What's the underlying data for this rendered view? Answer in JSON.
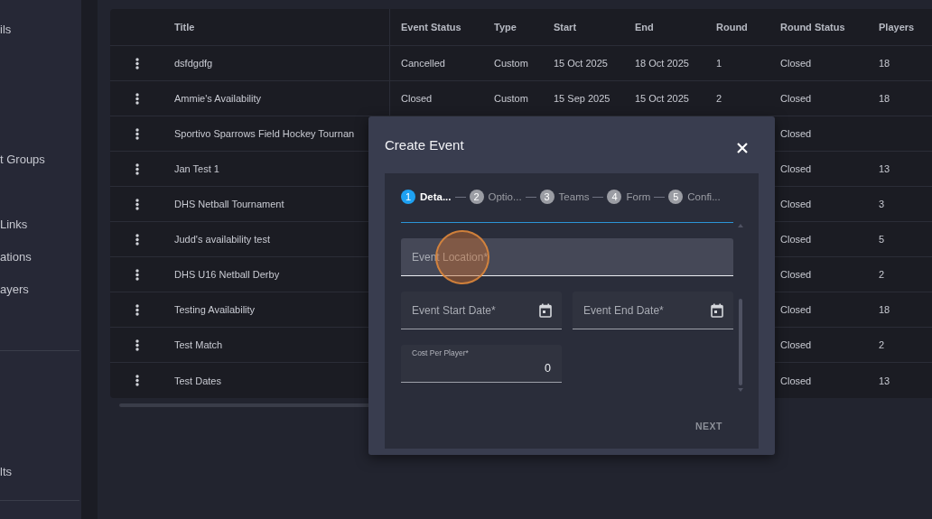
{
  "sidebar": {
    "items": [
      "ils",
      "t Groups",
      "Links",
      "ations",
      "ayers",
      "lts"
    ]
  },
  "table": {
    "columns": [
      "Title",
      "Event Status",
      "Type",
      "Start",
      "End",
      "Round",
      "Round Status",
      "Players"
    ],
    "rows": [
      {
        "title": "dsfdgdfg",
        "event_status": "Cancelled",
        "type": "Custom",
        "start": "15 Oct 2025",
        "end": "18 Oct 2025",
        "round": "1",
        "round_status": "Closed",
        "players": "18"
      },
      {
        "title": "Ammie's Availability",
        "event_status": "Closed",
        "type": "Custom",
        "start": "15 Sep 2025",
        "end": "15 Oct 2025",
        "round": "2",
        "round_status": "Closed",
        "players": "18"
      },
      {
        "title": "Sportivo Sparrows Field Hockey Tournan",
        "round_status": "Closed"
      },
      {
        "title": "Jan Test 1",
        "round_status": "Closed",
        "players": "13"
      },
      {
        "title": "DHS Netball Tournament",
        "round_status": "Closed",
        "players": "3"
      },
      {
        "title": "Judd's availability test",
        "round_status": "Closed",
        "players": "5"
      },
      {
        "title": "DHS U16 Netball Derby",
        "round_status": "Closed",
        "players": "2"
      },
      {
        "title": "Testing Availability",
        "round_status": "Closed",
        "players": "18"
      },
      {
        "title": "Test Match",
        "round_status": "Closed",
        "players": "2"
      },
      {
        "title": "Test Dates",
        "round_status": "Closed",
        "players": "13"
      }
    ]
  },
  "dialog": {
    "title": "Create Event",
    "steps": [
      {
        "number": "1",
        "label": "Deta...",
        "selected": true
      },
      {
        "number": "2",
        "label": "Optio...",
        "selected": false
      },
      {
        "number": "3",
        "label": "Teams",
        "selected": false
      },
      {
        "number": "4",
        "label": "Form",
        "selected": false
      },
      {
        "number": "5",
        "label": "Confi...",
        "selected": false
      }
    ],
    "location": {
      "placeholder": "Event Location*"
    },
    "start_date": {
      "placeholder": "Event Start Date*"
    },
    "end_date": {
      "placeholder": "Event End Date*"
    },
    "cost": {
      "label": "Cost Per Player*",
      "value": "0"
    },
    "next_button": {
      "label": "NEXT",
      "disabled": true
    }
  }
}
